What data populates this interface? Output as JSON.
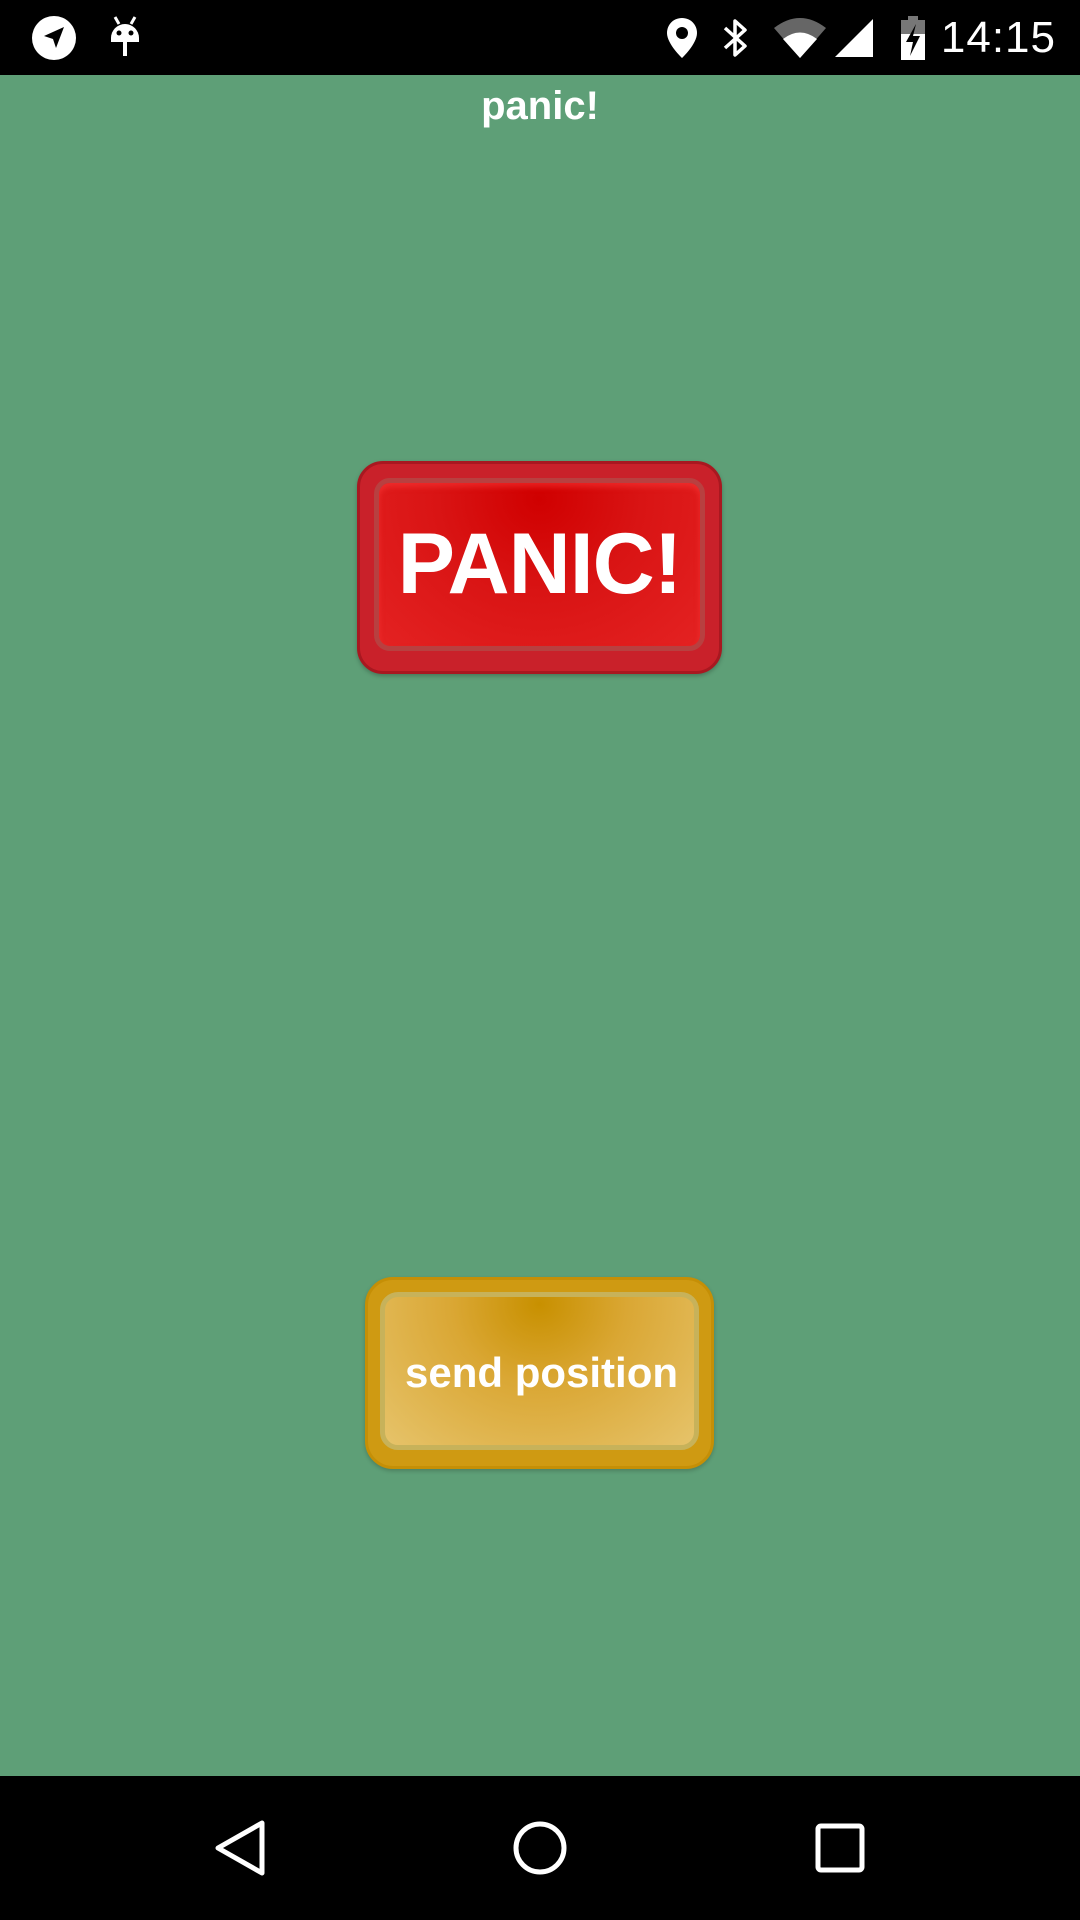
{
  "status_bar": {
    "time": "14:15",
    "icons": [
      "navigation-icon",
      "android-debug-icon",
      "location-pin-icon",
      "bluetooth-icon",
      "wifi-icon",
      "signal-icon",
      "battery-charging-icon"
    ]
  },
  "app": {
    "title": "panic!"
  },
  "buttons": {
    "panic_label": "PANIC!",
    "send_position_label": "send position"
  },
  "nav_bar": {
    "icons": [
      "back-icon",
      "home-icon",
      "recents-icon"
    ]
  },
  "colors": {
    "background": "#5e9f77",
    "panic_red": "#d91414",
    "send_gold": "#daa734",
    "bars": "#000000"
  }
}
